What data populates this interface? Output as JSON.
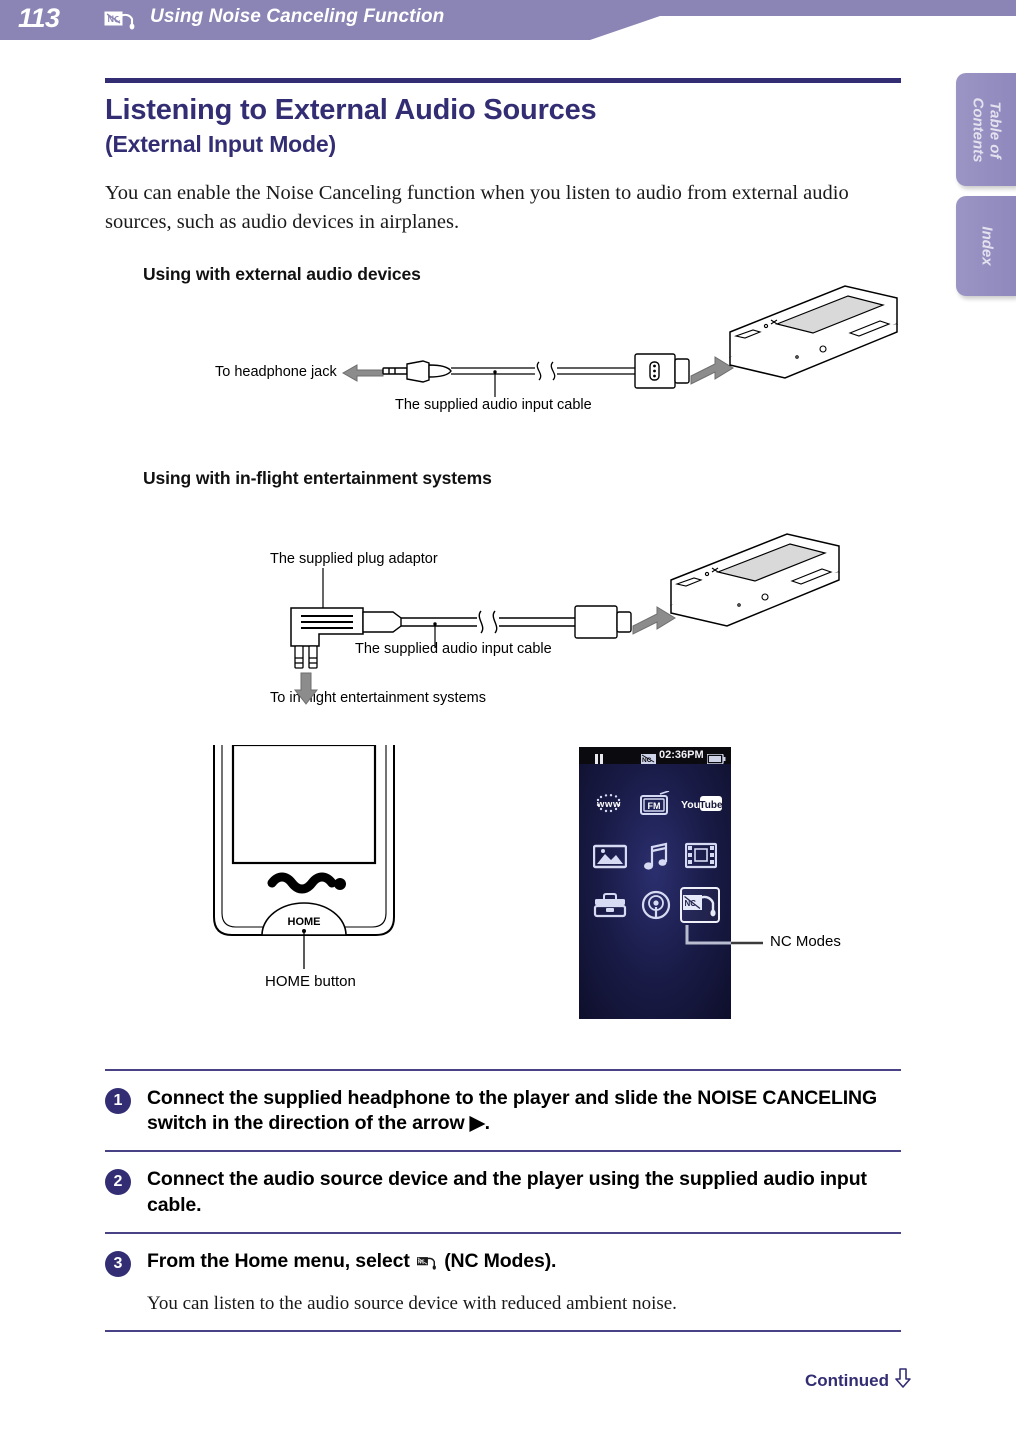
{
  "header": {
    "page_number": "113",
    "icon": "noise-canceling-headphone-icon",
    "title": "Using Noise Canceling Function",
    "band_color": "#8a85b5"
  },
  "side_tabs": [
    {
      "label": "Table of\nContents",
      "line1": "Table of",
      "line2": "Contents",
      "name": "table-of-contents-tab"
    },
    {
      "label": "Index",
      "line1": "Index",
      "line2": "",
      "name": "index-tab"
    }
  ],
  "title": {
    "line1": "Listening to External Audio Sources",
    "line2": "(External Input Mode)",
    "color": "#332e73"
  },
  "intro": "You can enable the Noise Canceling function when you listen to audio from external audio sources, such as audio devices in airplanes.",
  "figure1": {
    "heading": "Using with external audio devices",
    "label_left": "To headphone jack",
    "label_cable": "The supplied audio input cable"
  },
  "figure2": {
    "heading": "Using with in-flight entertainment systems",
    "label_adaptor": "The supplied plug adaptor",
    "label_cable": "The supplied audio input cable",
    "label_destination": "To in-flight entertainment systems"
  },
  "figure3": {
    "home_button_label": "HOME button",
    "home_button_text": "HOME",
    "walkman_logo": "WALKMAN-swirl-logo"
  },
  "home_screen": {
    "status_bar": {
      "playback_icon": "pause-icon",
      "nc_icon": "noise-canceling-icon",
      "time": "02:36PM",
      "battery_icon": "battery-icon"
    },
    "icons": [
      {
        "name": "internet-browser-icon",
        "label": "www"
      },
      {
        "name": "fm-radio-icon",
        "label": "FM"
      },
      {
        "name": "youtube-icon",
        "label": "You Tube"
      },
      {
        "name": "photos-icon",
        "label": ""
      },
      {
        "name": "music-icon",
        "label": ""
      },
      {
        "name": "videos-icon",
        "label": ""
      },
      {
        "name": "settings-toolbox-icon",
        "label": ""
      },
      {
        "name": "podcast-icon",
        "label": ""
      },
      {
        "name": "nc-modes-icon",
        "label": ""
      }
    ],
    "callout_label": "NC Modes"
  },
  "steps": [
    {
      "number": "1",
      "text": "Connect the supplied headphone to the player and slide the NOISE CANCELING switch in the direction of the arrow ▶."
    },
    {
      "number": "2",
      "text": "Connect the audio source device and the player using the supplied audio input cable."
    },
    {
      "number": "3",
      "text_before": "From the Home menu, select ",
      "text_after": " (NC Modes).",
      "note": "You can listen to the audio source device with reduced ambient noise."
    }
  ],
  "footer": {
    "continued_label": "Continued",
    "continued_icon": "down-arrow-icon"
  }
}
